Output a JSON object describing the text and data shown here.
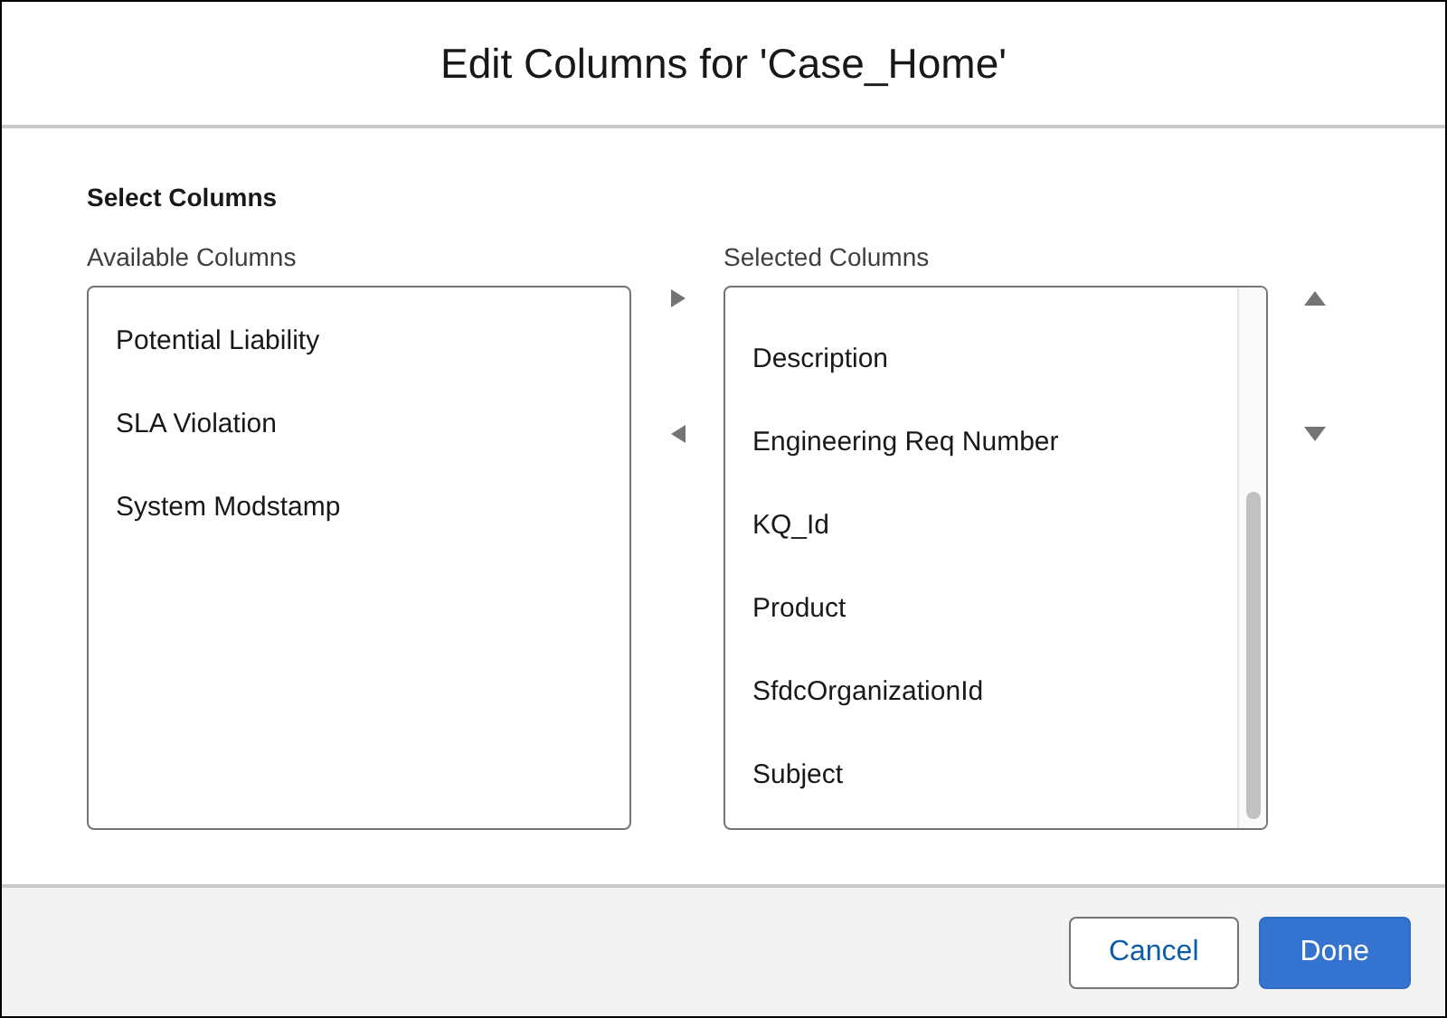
{
  "dialog": {
    "title": "Edit Columns for 'Case_Home'"
  },
  "section_title": "Select Columns",
  "available": {
    "label": "Available Columns",
    "items": [
      "Potential Liability",
      "SLA Violation",
      "System Modstamp"
    ]
  },
  "selected": {
    "label": "Selected Columns",
    "items": [
      "Description",
      "Engineering Req Number",
      "KQ_Id",
      "Product",
      "SfdcOrganizationId",
      "Subject"
    ]
  },
  "buttons": [
    {
      "label": "Cancel",
      "kind": "neutral"
    },
    {
      "label": "Done",
      "kind": "brand"
    }
  ]
}
